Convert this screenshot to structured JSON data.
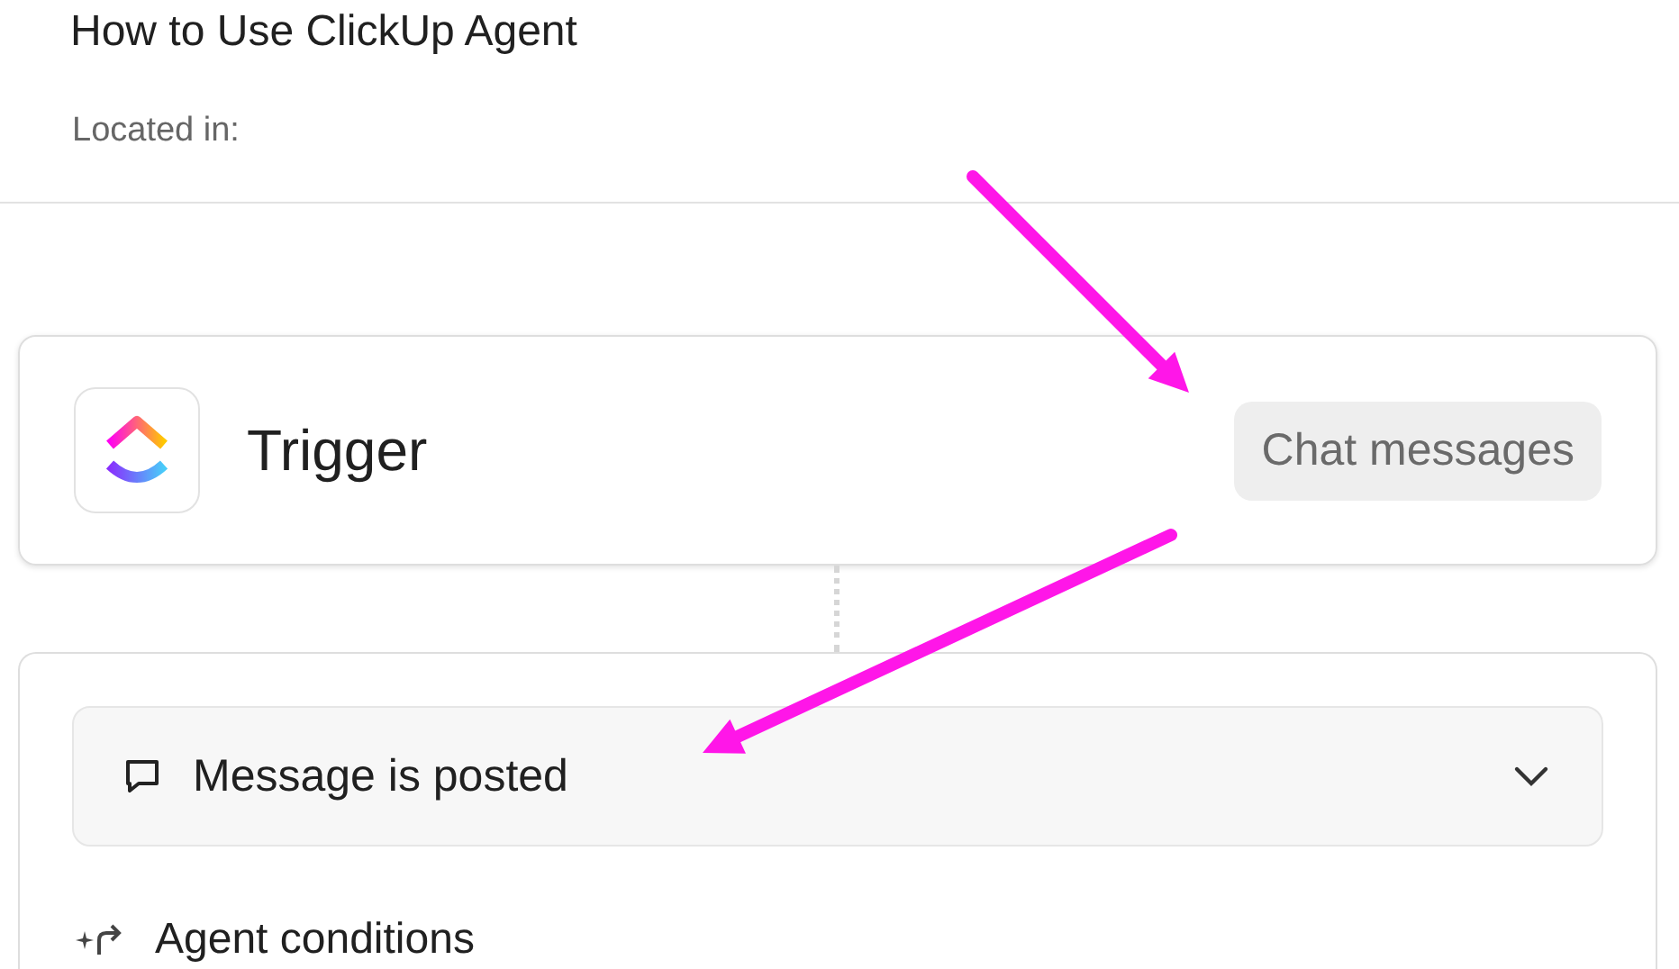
{
  "header": {
    "title": "How to Use ClickUp Agent",
    "location_label": "Located in:"
  },
  "trigger": {
    "title": "Trigger",
    "chip": "Chat messages"
  },
  "event": {
    "label": "Message is posted",
    "expanded": false
  },
  "conditions": {
    "label": "Agent conditions"
  }
}
